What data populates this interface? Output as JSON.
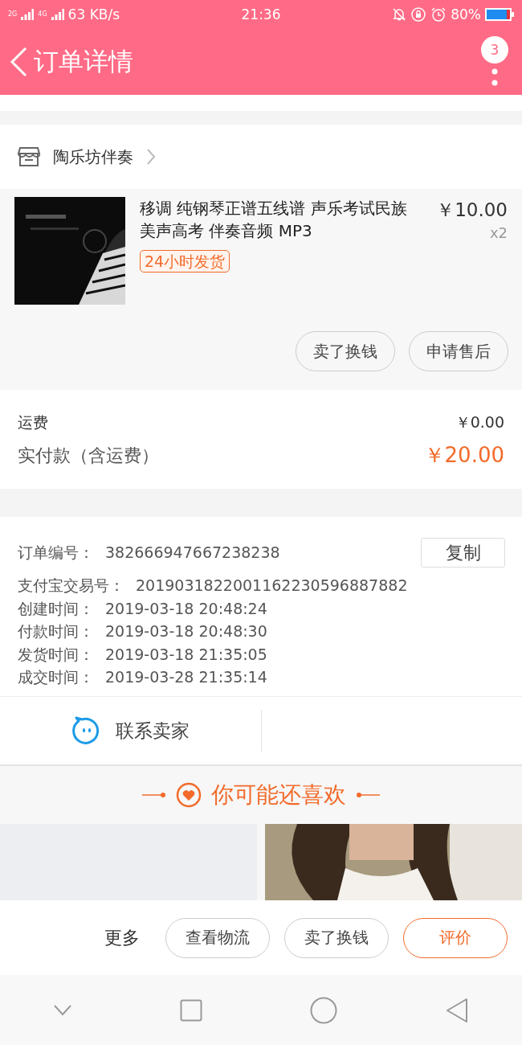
{
  "status_bar": {
    "signal_labels": [
      "2G",
      "4G"
    ],
    "speed": "63 KB/s",
    "time": "21:36",
    "battery": "80%"
  },
  "header": {
    "title": "订单详情",
    "badge": "3"
  },
  "shop": {
    "name": "陶乐坊伴奏"
  },
  "product": {
    "title": "移调 纯钢琴正谱五线谱 声乐考试民族美声高考 伴奏音频 MP3",
    "price": "￥10.00",
    "quantity": "x2",
    "tag": "24小时发货",
    "buttons": [
      "卖了换钱",
      "申请售后"
    ]
  },
  "fees": {
    "shipping_label": "运费",
    "shipping": "￥0.00",
    "total_label": "实付款（含运费）",
    "total": "￥20.00"
  },
  "order_info": {
    "copy_button": "复制",
    "rows": [
      {
        "label": "订单编号：",
        "value": "382666947667238238"
      },
      {
        "label": "支付宝交易号：",
        "value": "2019031822001162230596887882"
      },
      {
        "label": "创建时间：",
        "value": "2019-03-18 20:48:24"
      },
      {
        "label": "付款时间：",
        "value": "2019-03-18 20:48:30"
      },
      {
        "label": "发货时间：",
        "value": "2019-03-18 21:35:05"
      },
      {
        "label": "成交时间：",
        "value": "2019-03-28 21:35:14"
      }
    ]
  },
  "contact": {
    "label": "联系卖家"
  },
  "recommend": {
    "title": "你可能还喜欢",
    "items": [
      {
        "kind": "blank"
      },
      {
        "kind": "picture"
      }
    ]
  },
  "actions": {
    "more": "更多",
    "buttons": [
      {
        "label": "查看物流",
        "kind": "default"
      },
      {
        "label": "卖了换钱",
        "kind": "default"
      },
      {
        "label": "评价",
        "kind": "primary"
      }
    ]
  }
}
